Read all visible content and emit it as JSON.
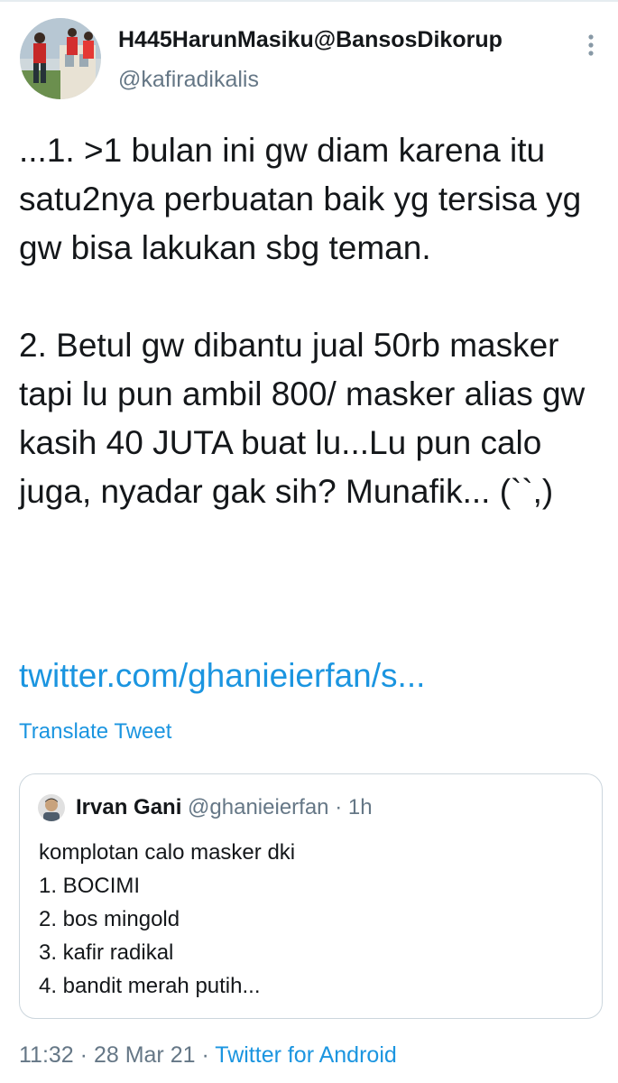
{
  "tweet": {
    "display_name": "H445HarunMasiku@BansosDikorup",
    "handle": "@kafiradikalis",
    "text": "...1. >1 bulan ini gw diam karena itu satu2nya perbuatan baik yg tersisa yg gw bisa lakukan sbg teman.\n\n2. Betul gw dibantu jual 50rb masker tapi lu pun ambil 800/ masker alias gw kasih 40 JUTA buat lu...Lu pun calo juga, nyadar gak sih? Munafik... (``,)",
    "link": "twitter.com/ghanieierfan/s...",
    "translate_label": "Translate Tweet",
    "time": "11:32",
    "separator": "·",
    "date": "28 Mar 21",
    "source": "Twitter for Android",
    "more_icon": "more-vertical-icon"
  },
  "quoted_tweet": {
    "display_name": "Irvan Gani",
    "handle": "@ghanieierfan",
    "separator": "·",
    "time": "1h",
    "text": "komplotan calo masker dki\n1. BOCIMI\n2. bos mingold\n3. kafir radikal\n4. bandit merah putih..."
  },
  "colors": {
    "text_primary": "#14171a",
    "text_secondary": "#657786",
    "link": "#1b95e0",
    "border": "#ccd6dd"
  }
}
